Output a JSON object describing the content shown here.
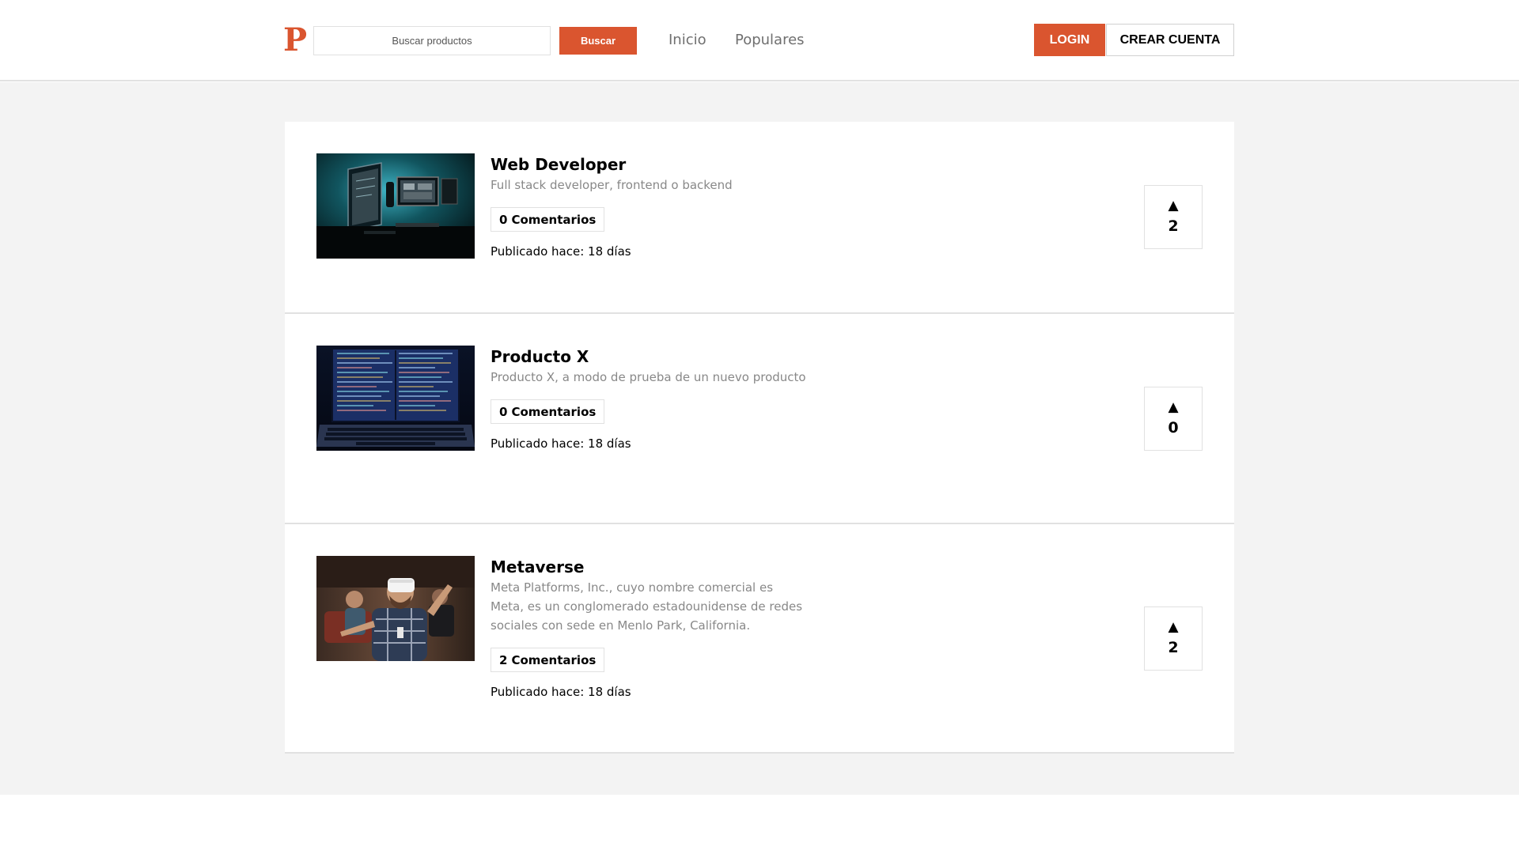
{
  "header": {
    "logo": "P",
    "search": {
      "placeholder": "Buscar productos",
      "button_label": "Buscar"
    },
    "nav": [
      {
        "label": "Inicio"
      },
      {
        "label": "Populares"
      }
    ],
    "login_label": "LOGIN",
    "signup_label": "CREAR CUENTA",
    "accent_color": "#da552f"
  },
  "products": [
    {
      "title": "Web Developer",
      "description": "Full stack developer, frontend o backend",
      "comment_count": "0",
      "comments_label": "Comentarios",
      "published": "Publicado hace: 18 días",
      "votes": "2",
      "vote_icon": "▲",
      "image": "desk-monitors-photo"
    },
    {
      "title": "Producto X",
      "description": "Producto X, a modo de prueba de un nuevo producto",
      "comment_count": "0",
      "comments_label": "Comentarios",
      "published": "Publicado hace: 18 días",
      "votes": "0",
      "vote_icon": "▲",
      "image": "laptop-code-photo"
    },
    {
      "title": "Metaverse",
      "description": "Meta Platforms, Inc.,  cuyo nombre comercial es Meta, es un conglomerado estadounidense de redes sociales con sede en Menlo Park, California.",
      "comment_count": "2",
      "comments_label": "Comentarios",
      "published": "Publicado hace: 18 días",
      "votes": "2",
      "vote_icon": "▲",
      "image": "vr-headset-photo"
    }
  ]
}
